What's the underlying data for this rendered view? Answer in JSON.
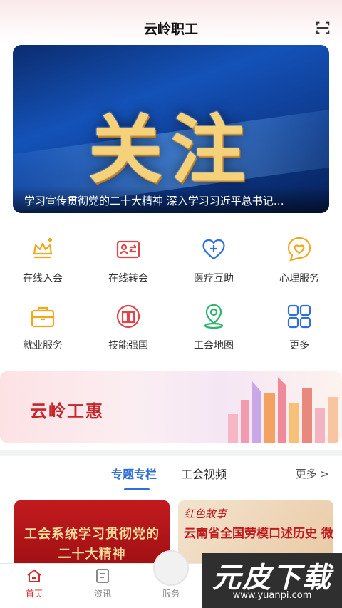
{
  "header": {
    "title": "云岭职工",
    "scan_icon": "scan-icon"
  },
  "banner": {
    "headline": "关注",
    "caption": "学习宣传贯彻党的二十大精神 深入学习习近平总书记…"
  },
  "services": [
    {
      "label": "在线入会",
      "icon": "crown-plus-icon",
      "color": "#f0a81e"
    },
    {
      "label": "在线转会",
      "icon": "id-transfer-icon",
      "color": "#e0454a"
    },
    {
      "label": "医疗互助",
      "icon": "heart-plus-icon",
      "color": "#2f6fd9"
    },
    {
      "label": "心理服务",
      "icon": "heart-chat-icon",
      "color": "#f0a81e"
    },
    {
      "label": "就业服务",
      "icon": "briefcase-icon",
      "color": "#f0a81e"
    },
    {
      "label": "技能强国",
      "icon": "book-icon",
      "color": "#e0454a"
    },
    {
      "label": "工会地图",
      "icon": "map-pin-icon",
      "color": "#2bb46b"
    },
    {
      "label": "更多",
      "icon": "apps-grid-icon",
      "color": "#2f6fd9"
    }
  ],
  "promo": {
    "title": "云岭工惠"
  },
  "tabs": {
    "active": "专题专栏",
    "second": "工会视频",
    "more": "更多 >"
  },
  "cards": [
    {
      "text": "工会系统学习贯彻党的二十大精神"
    },
    {
      "script": "红色故事",
      "text": "云南省全国劳模口述历史 微视频"
    }
  ],
  "bottom_nav": [
    {
      "label": "首页",
      "icon": "home-icon"
    },
    {
      "label": "资讯",
      "icon": "news-icon"
    },
    {
      "label": "服务",
      "icon": "service-icon"
    }
  ],
  "watermark": {
    "main": "元皮下载",
    "url": "www.yuanpi.com"
  },
  "colors": {
    "accent_blue": "#2f6fd9",
    "accent_red": "#d32a2a",
    "gold": "#f0a81e"
  }
}
